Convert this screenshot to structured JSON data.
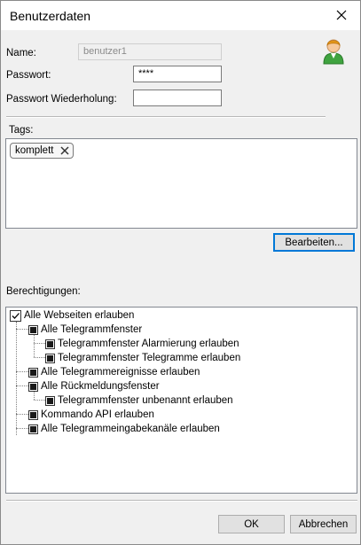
{
  "window": {
    "title": "Benutzerdaten",
    "close_icon": "close-icon"
  },
  "form": {
    "name_label": "Name:",
    "name_value": "benutzer1",
    "password_label": "Passwort:",
    "password_value": "****",
    "password_repeat_label": "Passwort Wiederholung:",
    "password_repeat_value": ""
  },
  "user_icon": "user-icon",
  "tags": {
    "label": "Tags:",
    "items": [
      {
        "label": "komplett",
        "remove_icon": "x-icon"
      }
    ]
  },
  "edit_button": "Bearbeiten...",
  "permissions": {
    "label": "Berechtigungen:",
    "root": {
      "label": "Alle Webseiten erlauben",
      "state": "checked"
    },
    "items": [
      {
        "label": "Alle Telegrammfenster",
        "state": "partial",
        "level": 1
      },
      {
        "label": "Telegrammfenster Alarmierung erlauben",
        "state": "partial",
        "level": 2
      },
      {
        "label": "Telegrammfenster Telegramme erlauben",
        "state": "partial",
        "level": 2
      },
      {
        "label": "Alle Telegrammereignisse erlauben",
        "state": "partial",
        "level": 1
      },
      {
        "label": "Alle Rückmeldungsfenster",
        "state": "partial",
        "level": 1
      },
      {
        "label": "Telegrammfenster unbenannt erlauben",
        "state": "partial",
        "level": 2
      },
      {
        "label": "Kommando API erlauben",
        "state": "partial",
        "level": 1
      },
      {
        "label": "Alle Telegrammeingabekanäle erlauben",
        "state": "partial",
        "level": 1
      }
    ]
  },
  "footer": {
    "ok": "OK",
    "cancel": "Abbrechen"
  }
}
